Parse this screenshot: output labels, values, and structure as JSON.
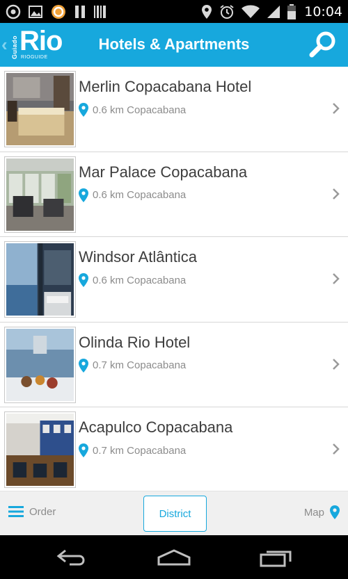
{
  "status_bar": {
    "time": "10:04",
    "left_icons": [
      "circle-target-icon",
      "image-icon",
      "orange-ring-icon",
      "pause-icon",
      "barcode-icon"
    ],
    "right_icons": [
      "location-icon",
      "alarm-icon",
      "wifi-icon",
      "signal-icon",
      "battery-icon"
    ]
  },
  "header": {
    "logo_main": "Rio",
    "logo_side": "Guiado",
    "logo_sub": "RIOGUIDE",
    "title": "Hotels & Apartments",
    "accent_color": "#17a8dd"
  },
  "hotels": [
    {
      "name": "Merlin Copacabana Hotel",
      "distance": "0.6 km Copacabana"
    },
    {
      "name": "Mar Palace Copacabana",
      "distance": "0.6 km Copacabana"
    },
    {
      "name": "Windsor Atlântica",
      "distance": "0.6 km Copacabana"
    },
    {
      "name": "Olinda Rio Hotel",
      "distance": "0.7 km Copacabana"
    },
    {
      "name": "Acapulco Copacabana",
      "distance": "0.7 km Copacabana"
    }
  ],
  "toolbar": {
    "order_label": "Order",
    "district_label": "District",
    "map_label": "Map"
  }
}
